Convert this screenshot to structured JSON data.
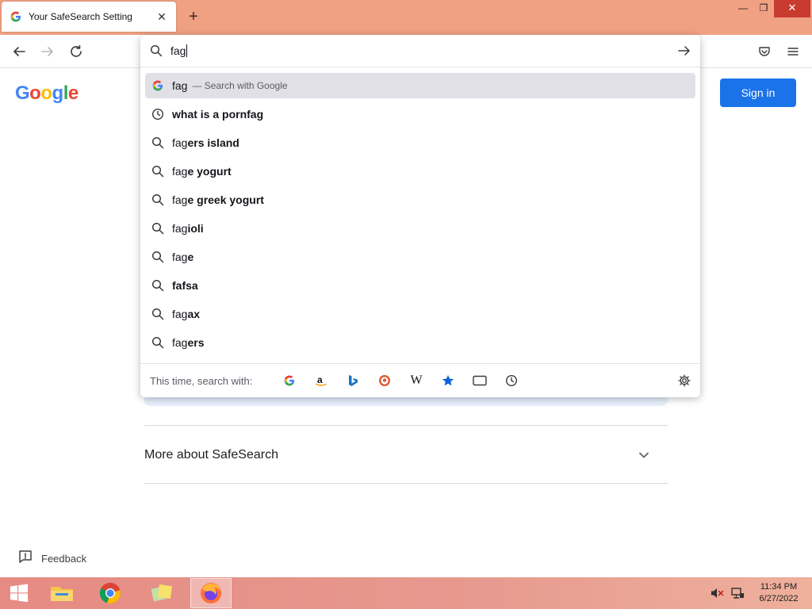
{
  "browser": {
    "tab_title": "Your SafeSearch Setting",
    "tab_close": "✕",
    "new_tab": "+",
    "window_controls": {
      "minimize": "—",
      "restore": "❐",
      "close": "✕"
    }
  },
  "url_bar": {
    "value": "fag",
    "suggestions": [
      {
        "icon": "google-icon",
        "typed": "fag",
        "completion": "",
        "hint": "— Search with Google"
      },
      {
        "icon": "history-icon",
        "typed": "",
        "completion": "what is a pornfag"
      },
      {
        "icon": "search-icon",
        "typed": "fag",
        "completion": "ers island"
      },
      {
        "icon": "search-icon",
        "typed": "fag",
        "completion": "e yogurt"
      },
      {
        "icon": "search-icon",
        "typed": "fag",
        "completion": "e greek yogurt"
      },
      {
        "icon": "search-icon",
        "typed": "fag",
        "completion": "ioli"
      },
      {
        "icon": "search-icon",
        "typed": "fag",
        "completion": "e"
      },
      {
        "icon": "search-icon",
        "typed": "",
        "completion": "fafsa"
      },
      {
        "icon": "search-icon",
        "typed": "fag",
        "completion": "ax"
      },
      {
        "icon": "search-icon",
        "typed": "fag",
        "completion": "ers"
      }
    ],
    "one_off_label": "This time, search with:",
    "one_off_engines": [
      "google-icon",
      "amazon-icon",
      "bing-icon",
      "duckduckgo-icon",
      "wikipedia-icon",
      "bookmarks-star-icon",
      "tabs-icon",
      "history-icon"
    ]
  },
  "page": {
    "logo": [
      "G",
      "o",
      "o",
      "g",
      "l",
      "e"
    ],
    "sign_in": "Sign in",
    "more_about": "More about SafeSearch",
    "feedback": "Feedback"
  },
  "taskbar": {
    "time": "11:34 PM",
    "date": "6/27/2022"
  },
  "colors": {
    "titlebar": "#f1a183",
    "google_blue": "#4285f4",
    "google_red": "#ea4335",
    "google_yellow": "#fbbc05",
    "google_green": "#34a853",
    "signin_button": "#1a73e8",
    "selected_suggestion": "#e0e0e6"
  }
}
